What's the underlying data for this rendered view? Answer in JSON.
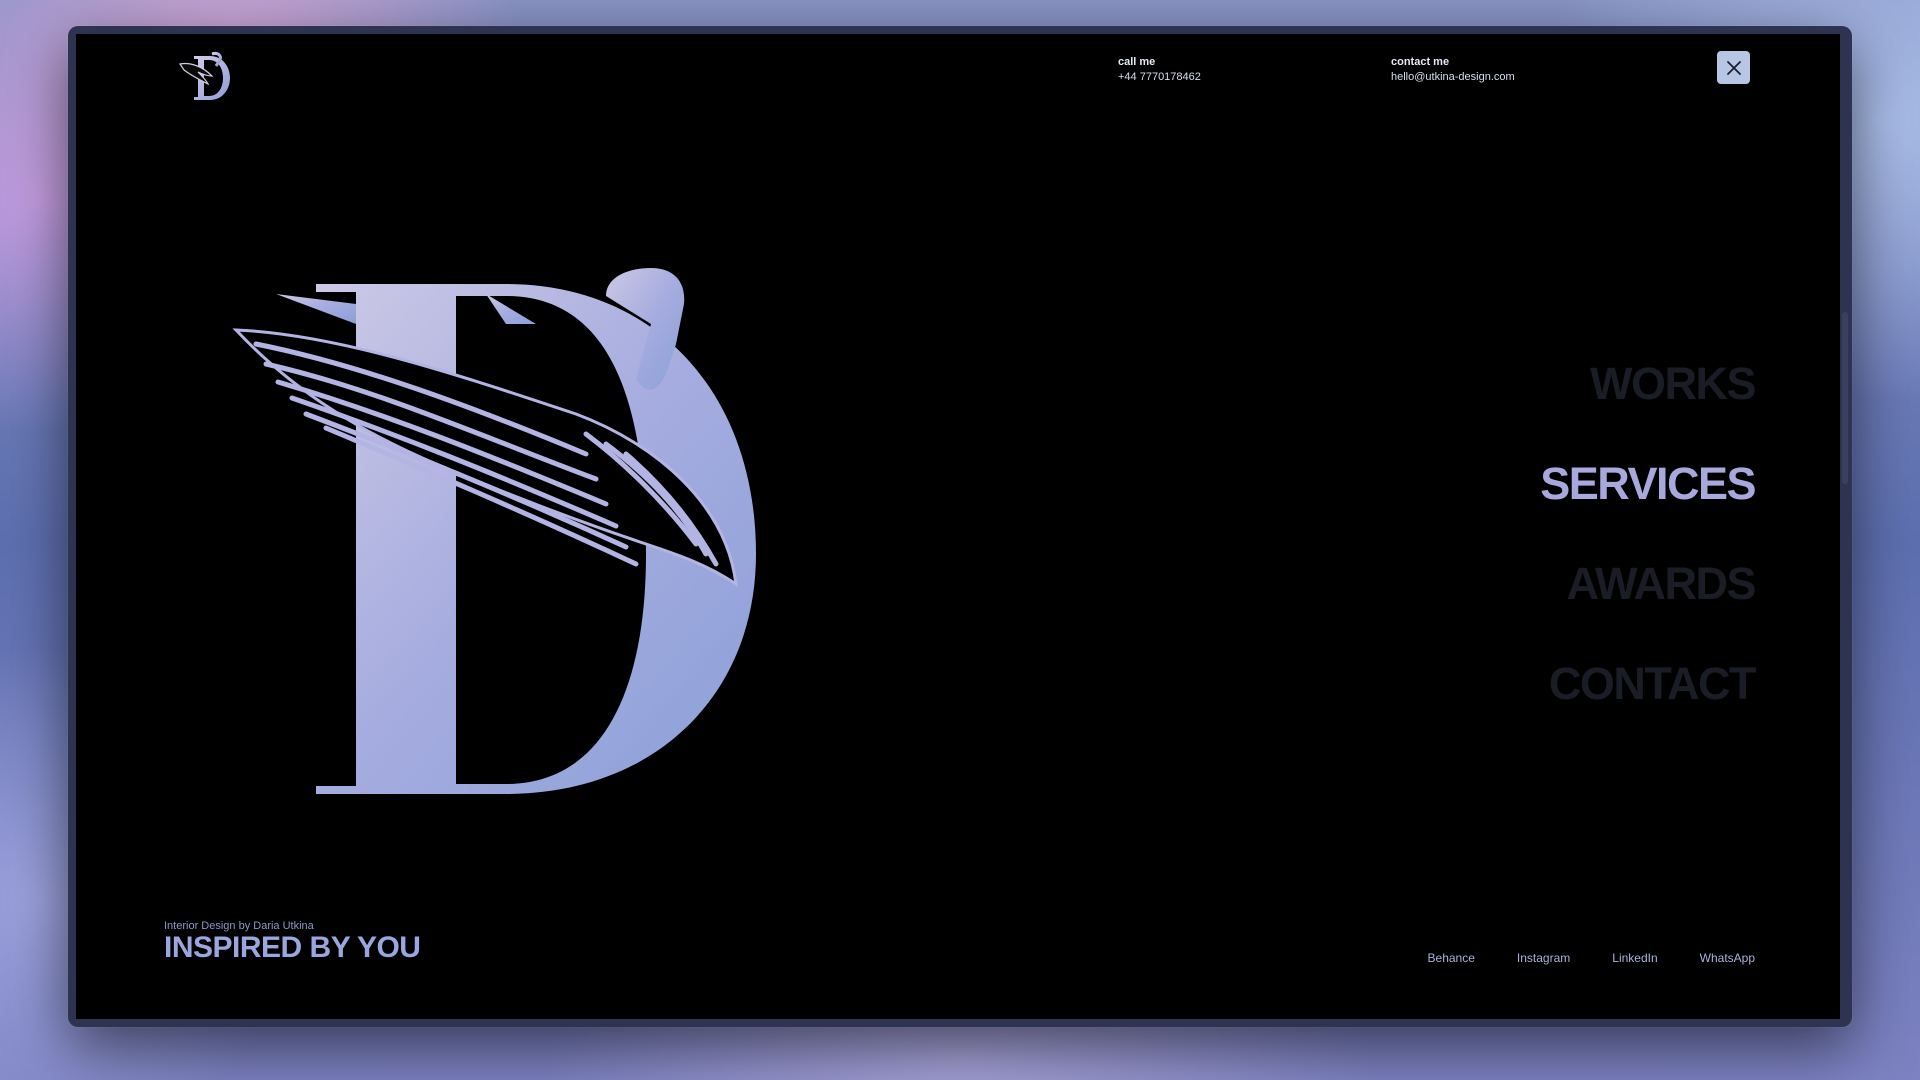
{
  "header": {
    "call": {
      "label": "call me",
      "value": "+44 7770178462"
    },
    "contact": {
      "label": "contact me",
      "value": "hello@utkina-design.com"
    },
    "close_icon": "close-icon"
  },
  "menu": {
    "items": [
      {
        "label": "WORKS"
      },
      {
        "label": "SERVICES"
      },
      {
        "label": "AWARDS"
      },
      {
        "label": "CONTACT"
      }
    ],
    "active": "SERVICES"
  },
  "footer": {
    "subtitle": "Interior Design by Daria Utkina",
    "title": "INSPIRED BY YOU",
    "socials": [
      "Behance",
      "Instagram",
      "LinkedIn",
      "WhatsApp"
    ]
  },
  "colors": {
    "accent": "#a8a8dc",
    "menu_inactive": "#1a1c26",
    "background": "#000000"
  }
}
